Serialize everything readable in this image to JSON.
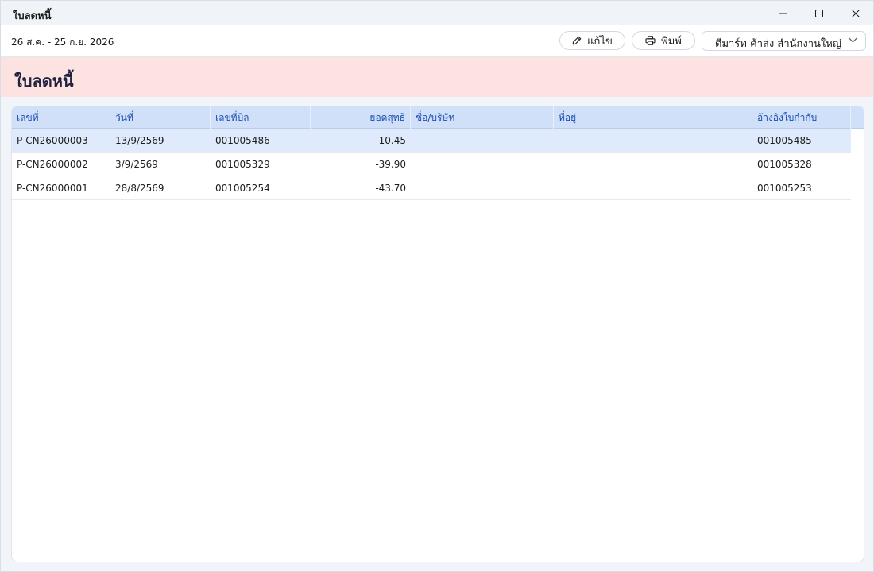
{
  "window": {
    "title": "ใบลดหนี้",
    "controls": {
      "minimize": "minimize-icon",
      "maximize": "maximize-icon",
      "close": "close-icon"
    }
  },
  "toolbar": {
    "date_range": "26 ส.ค. - 25 ก.ย. 2026",
    "edit_label": "แก้ไข",
    "print_label": "พิมพ์",
    "branch_value": "ดีมาร์ท ค้าส่ง สำนักงานใหญ่"
  },
  "banner": {
    "heading": "ใบลดหนี้"
  },
  "table": {
    "columns": [
      "เลขที่",
      "วันที่",
      "เลขที่บิล",
      "ยอดสุทธิ",
      "ชื่อ/บริษัท",
      "ที่อยู่",
      "อ้างอิงใบกำกับ"
    ],
    "rows": [
      {
        "no": "P-CN26000003",
        "date": "13/9/2569",
        "bill": "001005486",
        "net": "-10.45",
        "name": "",
        "address": "",
        "ref": "001005485",
        "selected": true
      },
      {
        "no": "P-CN26000002",
        "date": "3/9/2569",
        "bill": "001005329",
        "net": "-39.90",
        "name": "",
        "address": "",
        "ref": "001005328",
        "selected": false
      },
      {
        "no": "P-CN26000001",
        "date": "28/8/2569",
        "bill": "001005254",
        "net": "-43.70",
        "name": "",
        "address": "",
        "ref": "001005253",
        "selected": false
      }
    ]
  },
  "colors": {
    "accent": "#1d4fb3",
    "banner": "#fde2e2",
    "header": "#cfe0f8",
    "selected_row": "#dfebfd"
  }
}
